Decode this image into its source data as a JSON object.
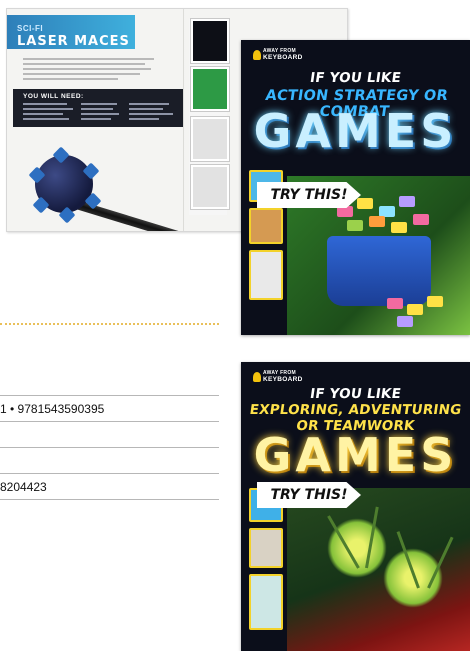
{
  "spread": {
    "kicker": "SCI-FI",
    "title": "LASER MACES",
    "need_heading": "YOU WILL NEED:"
  },
  "covers": [
    {
      "series_line1": "AWAY FROM",
      "series_line2": "KEYBOARD",
      "title_line1": "IF YOU LIKE",
      "title_line2": "ACTION STRATEGY OR COMBAT",
      "title_word": "GAMES",
      "badge": "TRY THIS!"
    },
    {
      "series_line1": "AWAY FROM",
      "series_line2": "KEYBOARD",
      "title_line1": "IF YOU LIKE",
      "title_line2": "EXPLORING, ADVENTURING",
      "title_line3": "OR TEAMWORK",
      "title_word": "GAMES",
      "badge": "TRY THIS!"
    }
  ],
  "info": {
    "isbn_line": "1 • 9781543590395",
    "number_line": "8204423"
  }
}
